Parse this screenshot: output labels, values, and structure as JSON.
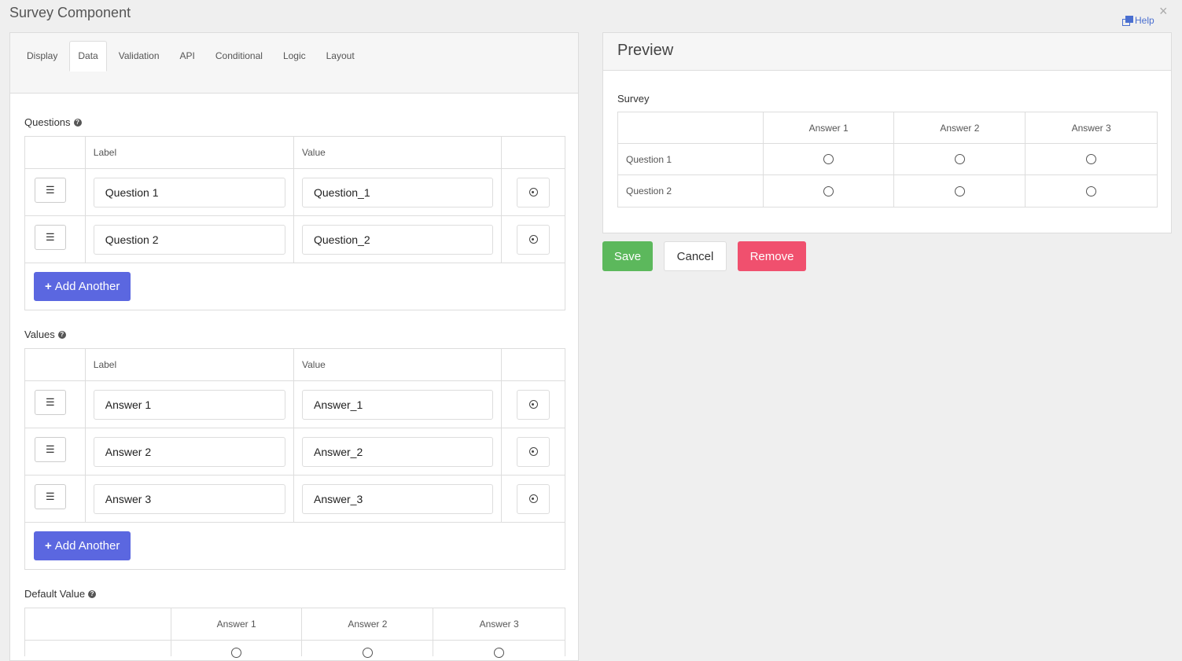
{
  "window": {
    "title": "Survey Component",
    "help_label": "Help",
    "close_glyph": "×"
  },
  "tabs": [
    "Display",
    "Data",
    "Validation",
    "API",
    "Conditional",
    "Logic",
    "Layout"
  ],
  "active_tab": "Data",
  "questions": {
    "label": "Questions",
    "col_label": "Label",
    "col_value": "Value",
    "rows": [
      {
        "label": "Question 1",
        "value": "Question_1"
      },
      {
        "label": "Question 2",
        "value": "Question_2"
      }
    ],
    "add_label": "Add Another"
  },
  "values": {
    "label": "Values",
    "col_label": "Label",
    "col_value": "Value",
    "rows": [
      {
        "label": "Answer 1",
        "value": "Answer_1"
      },
      {
        "label": "Answer 2",
        "value": "Answer_2"
      },
      {
        "label": "Answer 3",
        "value": "Answer_3"
      }
    ],
    "add_label": "Add Another"
  },
  "default_value": {
    "label": "Default Value",
    "columns": [
      "Answer 1",
      "Answer 2",
      "Answer 3"
    ]
  },
  "preview": {
    "title": "Preview",
    "survey_label": "Survey",
    "columns": [
      "Answer 1",
      "Answer 2",
      "Answer 3"
    ],
    "rows": [
      "Question 1",
      "Question 2"
    ]
  },
  "actions": {
    "save": "Save",
    "cancel": "Cancel",
    "remove": "Remove"
  },
  "colors": {
    "primary": "#5b67e0",
    "save": "#5cb85c",
    "remove": "#f0506e",
    "help_link": "#4a6fd0"
  }
}
